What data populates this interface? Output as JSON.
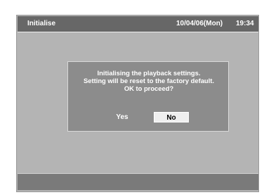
{
  "header": {
    "title": "Initialise",
    "date": "10/04/06(Mon)",
    "time": "19:34"
  },
  "dialog": {
    "line1": "Initialising the playback settings.",
    "line2": "Setting will be reset to the factory default.",
    "line3": "OK to proceed?",
    "yes_label": "Yes",
    "no_label": "No",
    "selected": "No"
  },
  "colors": {
    "frame": "#b4b4b4",
    "title_bar": "#676767",
    "dialog": "#8c8c8c",
    "selected_button": "#efefef"
  }
}
